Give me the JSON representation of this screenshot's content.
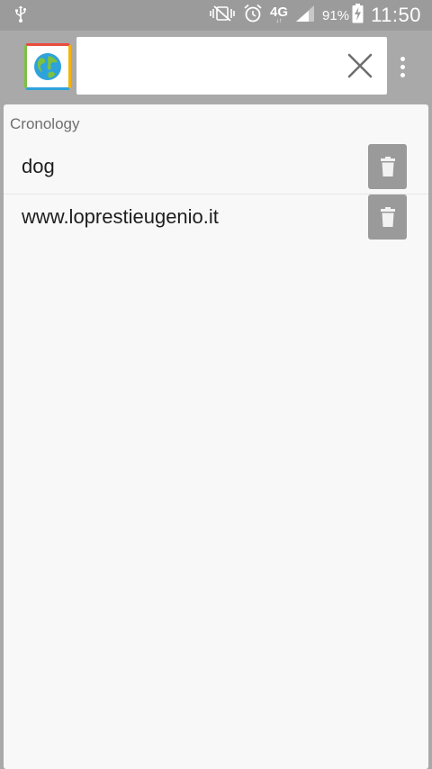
{
  "status_bar": {
    "usb_icon": "usb-icon",
    "network_type": "4G",
    "network_sub": "↓↑",
    "battery_percent": "91%",
    "time": "11:50"
  },
  "app_bar": {
    "logo_icon": "globe-icon",
    "search": {
      "value": "",
      "placeholder": ""
    },
    "clear_icon": "close-icon",
    "overflow_icon": "more-vert-icon"
  },
  "history": {
    "title": "Cronology",
    "items": [
      {
        "label": "dog"
      },
      {
        "label": "www.loprestieugenio.it"
      }
    ],
    "delete_icon": "trash-icon"
  },
  "colors": {
    "app_bar": "#a9a9a9",
    "status_bar": "#9b9b9b",
    "content_bg": "#f8f8f8",
    "delete_button": "#9a9a9a"
  }
}
